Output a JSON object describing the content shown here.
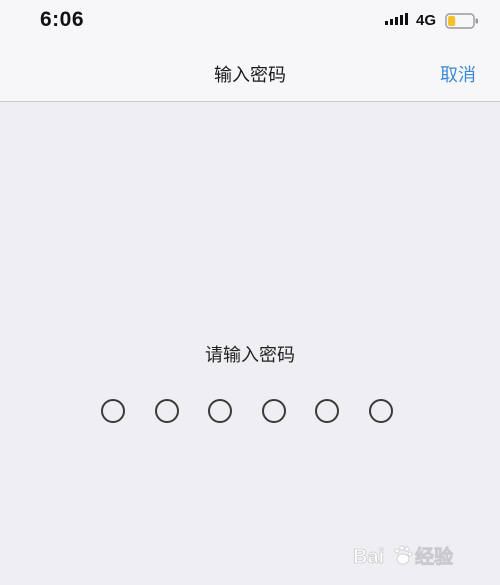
{
  "status_bar": {
    "time": "6:06",
    "network": "4G",
    "battery_level": 0.3,
    "signal_icon": "cellular-signal-icon",
    "battery_icon": "battery-icon",
    "battery_color": "#f2c12e"
  },
  "nav": {
    "title": "输入密码",
    "cancel_label": "取消",
    "accent_color": "#3d8ad8"
  },
  "passcode": {
    "prompt": "请输入密码",
    "length": 6,
    "entered": 0
  },
  "watermark": {
    "icon": "baidu-paw-logo",
    "text": "Baidu 经验"
  }
}
